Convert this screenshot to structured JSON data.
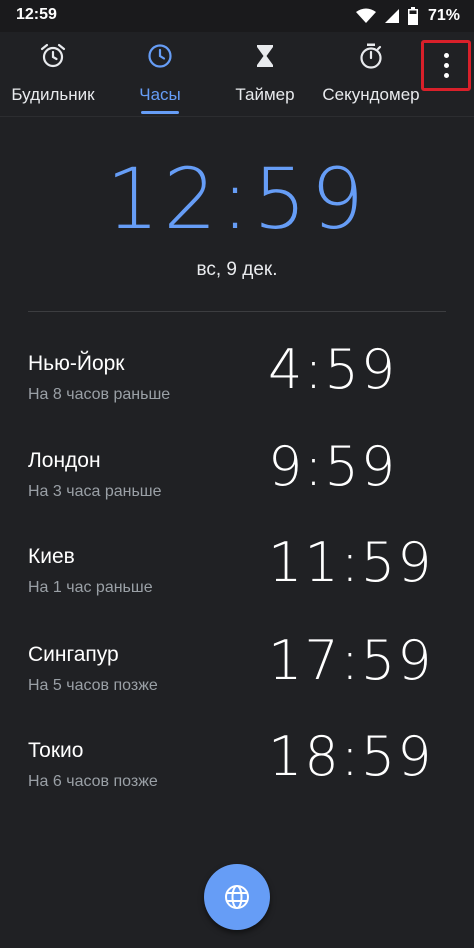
{
  "status_bar": {
    "time": "12:59",
    "battery": "71%",
    "icons": [
      "wifi-icon",
      "signal-icon",
      "battery-icon"
    ]
  },
  "tabs": [
    {
      "label": "Будильник",
      "icon": "alarm-icon",
      "active": false
    },
    {
      "label": "Часы",
      "icon": "clock-icon",
      "active": true
    },
    {
      "label": "Таймер",
      "icon": "hourglass-icon",
      "active": false
    },
    {
      "label": "Секундомер",
      "icon": "stopwatch-icon",
      "active": false
    }
  ],
  "menu": {
    "icon": "more-vert-icon"
  },
  "clock": {
    "time": "12:59",
    "date": "вс, 9 дек."
  },
  "cities": [
    {
      "name": "Нью-Йорк",
      "offset": "На 8 часов раньше",
      "time": "4:59"
    },
    {
      "name": "Лондон",
      "offset": "На 3 часа раньше",
      "time": "9:59"
    },
    {
      "name": "Киев",
      "offset": "На 1 час раньше",
      "time": "11:59"
    },
    {
      "name": "Сингапур",
      "offset": "На 5 часов позже",
      "time": "17:59"
    },
    {
      "name": "Токио",
      "offset": "На 6 часов позже",
      "time": "18:59"
    }
  ],
  "fab": {
    "icon": "globe-icon"
  },
  "colors": {
    "background": "#202124",
    "accent": "#669df6",
    "highlight_border": "#d9202a",
    "secondary_text": "#9aa0a6"
  }
}
